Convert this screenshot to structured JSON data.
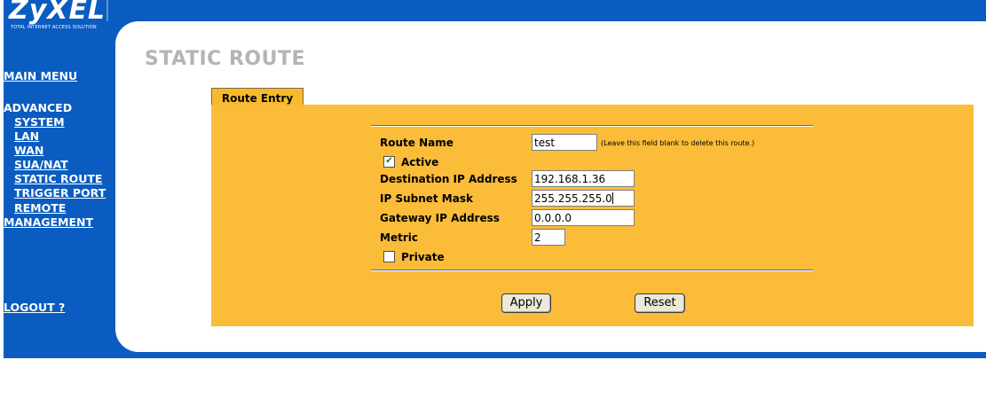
{
  "brand": {
    "logo": "ZyXEL",
    "tagline": "TOTAL INTERNET ACCESS SOLUTION"
  },
  "sidebar": {
    "main_menu": "MAIN MENU",
    "advanced": "ADVANCED",
    "items": [
      {
        "label": "SYSTEM"
      },
      {
        "label": "LAN"
      },
      {
        "label": "WAN"
      },
      {
        "label": "SUA/NAT"
      },
      {
        "label": "STATIC ROUTE"
      },
      {
        "label": "TRIGGER PORT"
      },
      {
        "label": "REMOTE"
      }
    ],
    "management": "MANAGEMENT",
    "logout": "LOGOUT ?"
  },
  "page": {
    "title": "STATIC ROUTE",
    "tab": "Route Entry"
  },
  "form": {
    "route_name_label": "Route Name",
    "route_name_value": "test",
    "route_name_hint": "(Leave this field blank to delete this route.)",
    "active_label": "Active",
    "active_checked": true,
    "dest_ip_label": "Destination IP Address",
    "dest_ip_value": "192.168.1.36",
    "subnet_label": "IP Subnet Mask",
    "subnet_value": "255.255.255.0",
    "gateway_label": "Gateway IP Address",
    "gateway_value": "0.0.0.0",
    "metric_label": "Metric",
    "metric_value": "2",
    "private_label": "Private",
    "private_checked": false
  },
  "buttons": {
    "apply": "Apply",
    "reset": "Reset"
  },
  "colors": {
    "nav_blue": "#0b5cc0",
    "panel_orange": "#fbbc3a",
    "title_gray": "#b4b4b4"
  }
}
